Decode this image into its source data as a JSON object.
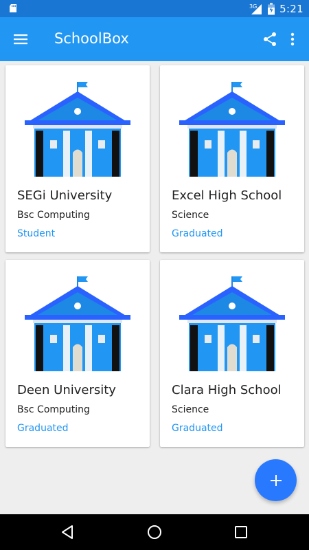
{
  "status_bar": {
    "time": "5:21",
    "network": "3G"
  },
  "app_bar": {
    "title": "SchoolBox"
  },
  "cards": [
    {
      "name": "SEGi University",
      "course": "Bsc Computing",
      "status": "Student"
    },
    {
      "name": "Excel High School",
      "course": "Science",
      "status": "Graduated"
    },
    {
      "name": "Deen University",
      "course": "Bsc Computing",
      "status": "Graduated"
    },
    {
      "name": "Clara High School",
      "course": "Science",
      "status": "Graduated"
    }
  ],
  "colors": {
    "primary": "#2196f3",
    "primary_dark": "#1976d2",
    "accent": "#2979ff",
    "status_text": "#2196f3"
  },
  "icons": [
    "sd-card-icon",
    "signal-icon",
    "battery-icon",
    "menu-icon",
    "share-icon",
    "more-vert-icon",
    "school-building-icon",
    "add-icon",
    "back-icon",
    "home-icon",
    "recents-icon"
  ]
}
